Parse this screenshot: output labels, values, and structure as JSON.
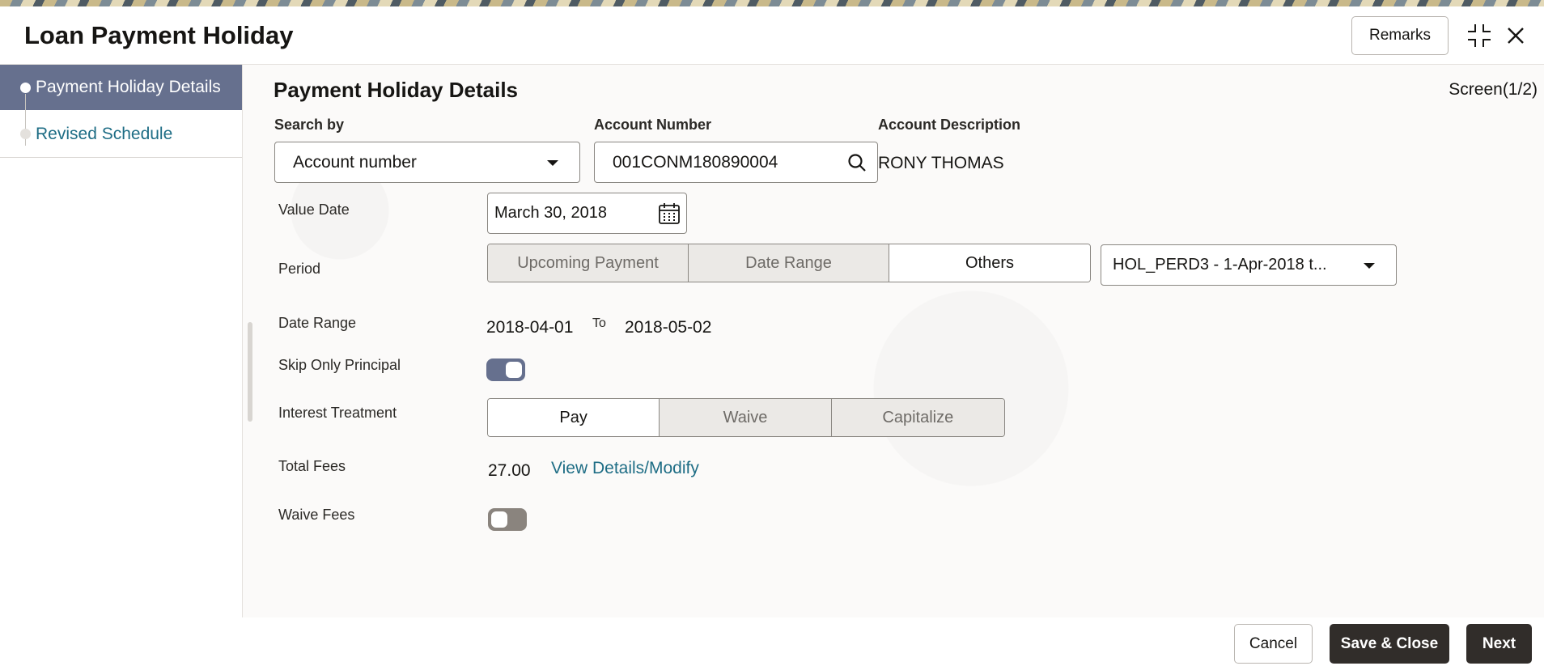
{
  "window": {
    "title": "Loan Payment Holiday",
    "remarks_label": "Remarks"
  },
  "sidebar": {
    "items": [
      {
        "label": "Payment Holiday Details",
        "active": true
      },
      {
        "label": "Revised Schedule",
        "active": false
      }
    ]
  },
  "main": {
    "section_title": "Payment Holiday Details",
    "screen_indicator": "Screen(1/2)",
    "search_by": {
      "label": "Search by",
      "value": "Account number"
    },
    "account_number": {
      "label": "Account Number",
      "value": "001CONM180890004"
    },
    "account_description": {
      "label": "Account Description",
      "value": "RONY THOMAS"
    },
    "value_date": {
      "label": "Value Date",
      "value": "March 30, 2018"
    },
    "period": {
      "label": "Period",
      "options": [
        "Upcoming Payment",
        "Date Range",
        "Others"
      ],
      "selected": "Others",
      "holiday_period_value": "HOL_PERD3 - 1-Apr-2018 t..."
    },
    "date_range": {
      "label": "Date Range",
      "from": "2018-04-01",
      "to_label": "To",
      "to": "2018-05-02"
    },
    "skip_only_principal": {
      "label": "Skip Only Principal",
      "on": true
    },
    "interest_treatment": {
      "label": "Interest Treatment",
      "options": [
        "Pay",
        "Waive",
        "Capitalize"
      ],
      "selected": "Pay"
    },
    "total_fees": {
      "label": "Total Fees",
      "value": "27.00",
      "link": "View Details/Modify"
    },
    "waive_fees": {
      "label": "Waive Fees",
      "on": false
    }
  },
  "footer": {
    "cancel_label": "Cancel",
    "save_close_label": "Save & Close",
    "next_label": "Next"
  },
  "colors": {
    "accent_nav": "#66708e",
    "link": "#1e6d85",
    "primary_button": "#312d2a",
    "toggle_off": "#8a847e"
  }
}
